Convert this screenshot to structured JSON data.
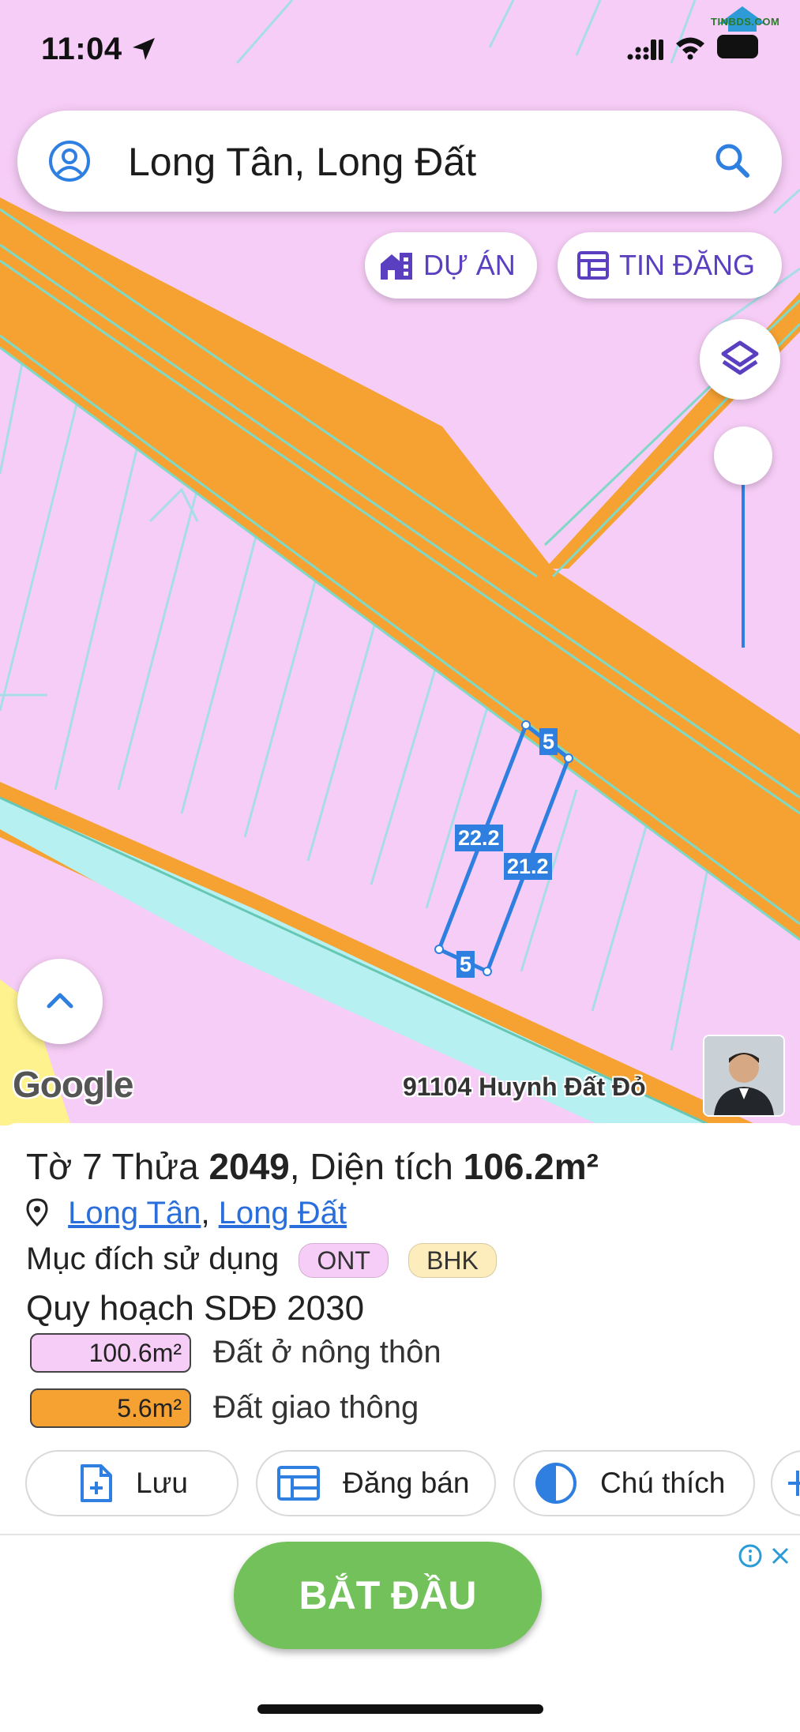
{
  "status_bar": {
    "time": "11:04",
    "watermark": "TINBDS.COM"
  },
  "search": {
    "query": "Long Tân, Long Đất"
  },
  "map_buttons": {
    "du_an": "DỰ ÁN",
    "tin_dang": "TIN ĐĂNG"
  },
  "map": {
    "google_logo": "Google",
    "owner_label": "91104 Huynh Đất Đỏ",
    "parcel_dimensions": {
      "top": "5",
      "left": "22.2",
      "right": "21.2",
      "bottom": "5"
    }
  },
  "parcel": {
    "title_prefix": "Tờ",
    "sheet": "7",
    "plot_label": "Thửa",
    "plot": "2049",
    "area_label": "Diện tích",
    "area": "106.2m²",
    "location_ward": "Long Tân",
    "location_separator": ",",
    "location_district": "Long Đất",
    "usage_label": "Mục đích sử dụng",
    "usage_tags": [
      {
        "code": "ONT",
        "color": "#f6cdf6"
      },
      {
        "code": "BHK",
        "color": "#fdedbc"
      }
    ],
    "planning_title": "Quy hoạch SDĐ 2030",
    "planning": [
      {
        "area": "100.6m²",
        "label": "Đất ở nông thôn",
        "color": "#f6cdf6"
      },
      {
        "area": "5.6m²",
        "label": "Đất giao thông",
        "color": "#f5a233"
      }
    ]
  },
  "actions": {
    "save": "Lưu",
    "post": "Đăng bán",
    "legend": "Chú thích"
  },
  "ad": {
    "cta": "BẮT ĐẦU"
  },
  "colors": {
    "accent": "#5a3fc0",
    "link": "#2a6edc",
    "road": "#f5a233",
    "water": "#b6f0f0",
    "residential": "#f6cdf6"
  }
}
